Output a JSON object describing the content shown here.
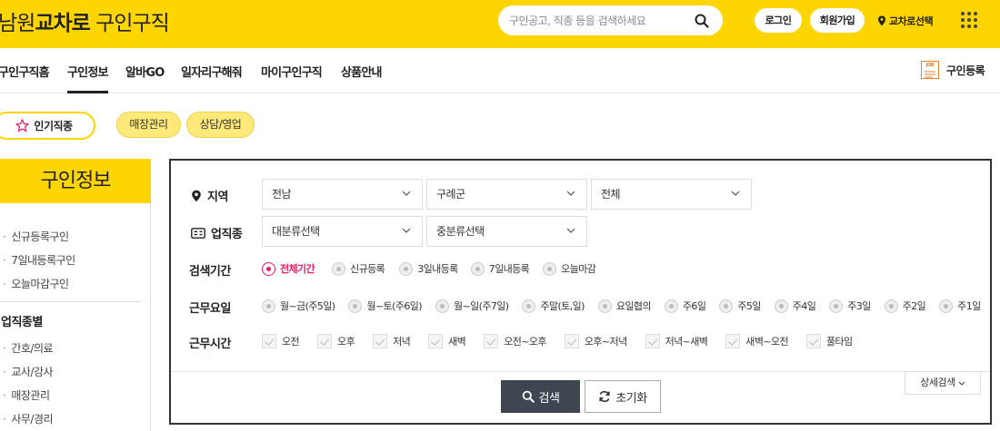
{
  "header": {
    "logo_region": "남원",
    "logo_brand": "교차로",
    "logo_suffix": "구인구직",
    "search_placeholder": "구인공고, 직종 등을 검색하세요",
    "login_label": "로그인",
    "join_label": "회원가입",
    "region_label": "교차로선택",
    "brand_color": "#ffd500"
  },
  "nav": {
    "items": [
      "구인구직홈",
      "구인정보",
      "알바GO",
      "일자리구해줘",
      "마이구인구직",
      "상품안내"
    ],
    "active": "구인정보",
    "register_label": "구인등록",
    "register_icon_text": "JOB"
  },
  "popular": {
    "title": "인기직종",
    "chips": [
      "매장관리",
      "상담/영업"
    ]
  },
  "sidebar": {
    "title": "구인정보",
    "items": [
      "신규등록구인",
      "7일내등록구인",
      "오늘마감구인"
    ],
    "section_title": "업직종별",
    "section_items": [
      "간호/의료",
      "교사/강사",
      "매장관리",
      "사무/경리"
    ]
  },
  "search": {
    "region_label": "지역",
    "region_selects": [
      "전남",
      "구례군",
      "전체"
    ],
    "job_label": "업직종",
    "job_selects": [
      "대분류선택",
      "중분류선택"
    ],
    "period_label": "검색기간",
    "period_options": [
      "전체기간",
      "신규등록",
      "3일내등록",
      "7일내등록",
      "오늘마감"
    ],
    "period_selected": "전체기간",
    "workday_label": "근무요일",
    "workday_options": [
      "월~금(주5일)",
      "월~토(주6일)",
      "월~일(주7일)",
      "주말(토,일)",
      "요일협의",
      "주6일",
      "주5일",
      "주4일",
      "주3일",
      "주2일",
      "주1일"
    ],
    "worktime_label": "근무시간",
    "worktime_options": [
      "오전",
      "오후",
      "저녁",
      "새벽",
      "오전~오후",
      "오후~저녁",
      "저녁~새벽",
      "새벽~오전",
      "풀타임"
    ],
    "detail_label": "상세검색",
    "search_button": "검색",
    "reset_button": "초기화",
    "accent_color": "#e91e63"
  }
}
